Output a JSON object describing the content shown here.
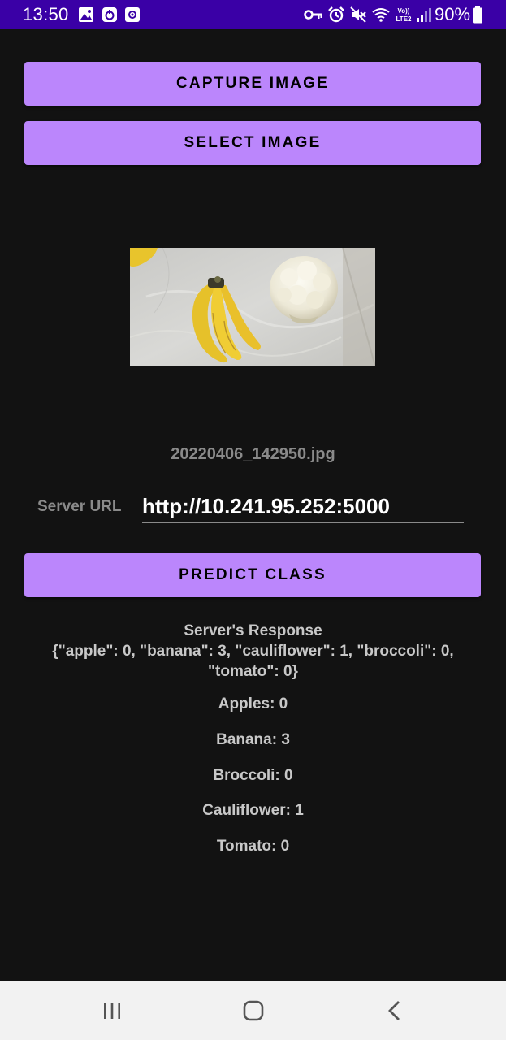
{
  "status_bar": {
    "time": "13:50",
    "battery": "90%",
    "icons": [
      "gallery-icon",
      "app-icon",
      "record-icon",
      "vpn-key-icon",
      "alarm-icon",
      "mute-icon",
      "wifi-icon",
      "volte-icon",
      "signal-icon",
      "battery-icon"
    ]
  },
  "buttons": {
    "capture": "CAPTURE IMAGE",
    "select": "SELECT IMAGE",
    "predict": "PREDICT CLASS"
  },
  "image": {
    "filename": "20220406_142950.jpg"
  },
  "server": {
    "label": "Server URL",
    "url": "http://10.241.95.252:5000"
  },
  "response": {
    "title": "Server's Response",
    "body": "{\"apple\": 0, \"banana\": 3, \"cauliflower\": 1, \"broccoli\": 0, \"tomato\": 0}"
  },
  "counts": [
    {
      "label": "Apples: 0"
    },
    {
      "label": "Banana: 3"
    },
    {
      "label": "Broccoli: 0"
    },
    {
      "label": "Cauliflower: 1"
    },
    {
      "label": "Tomato: 0"
    }
  ],
  "colors": {
    "status_bar": "#3a00a6",
    "accent": "#bb86fc",
    "background": "#121212"
  }
}
